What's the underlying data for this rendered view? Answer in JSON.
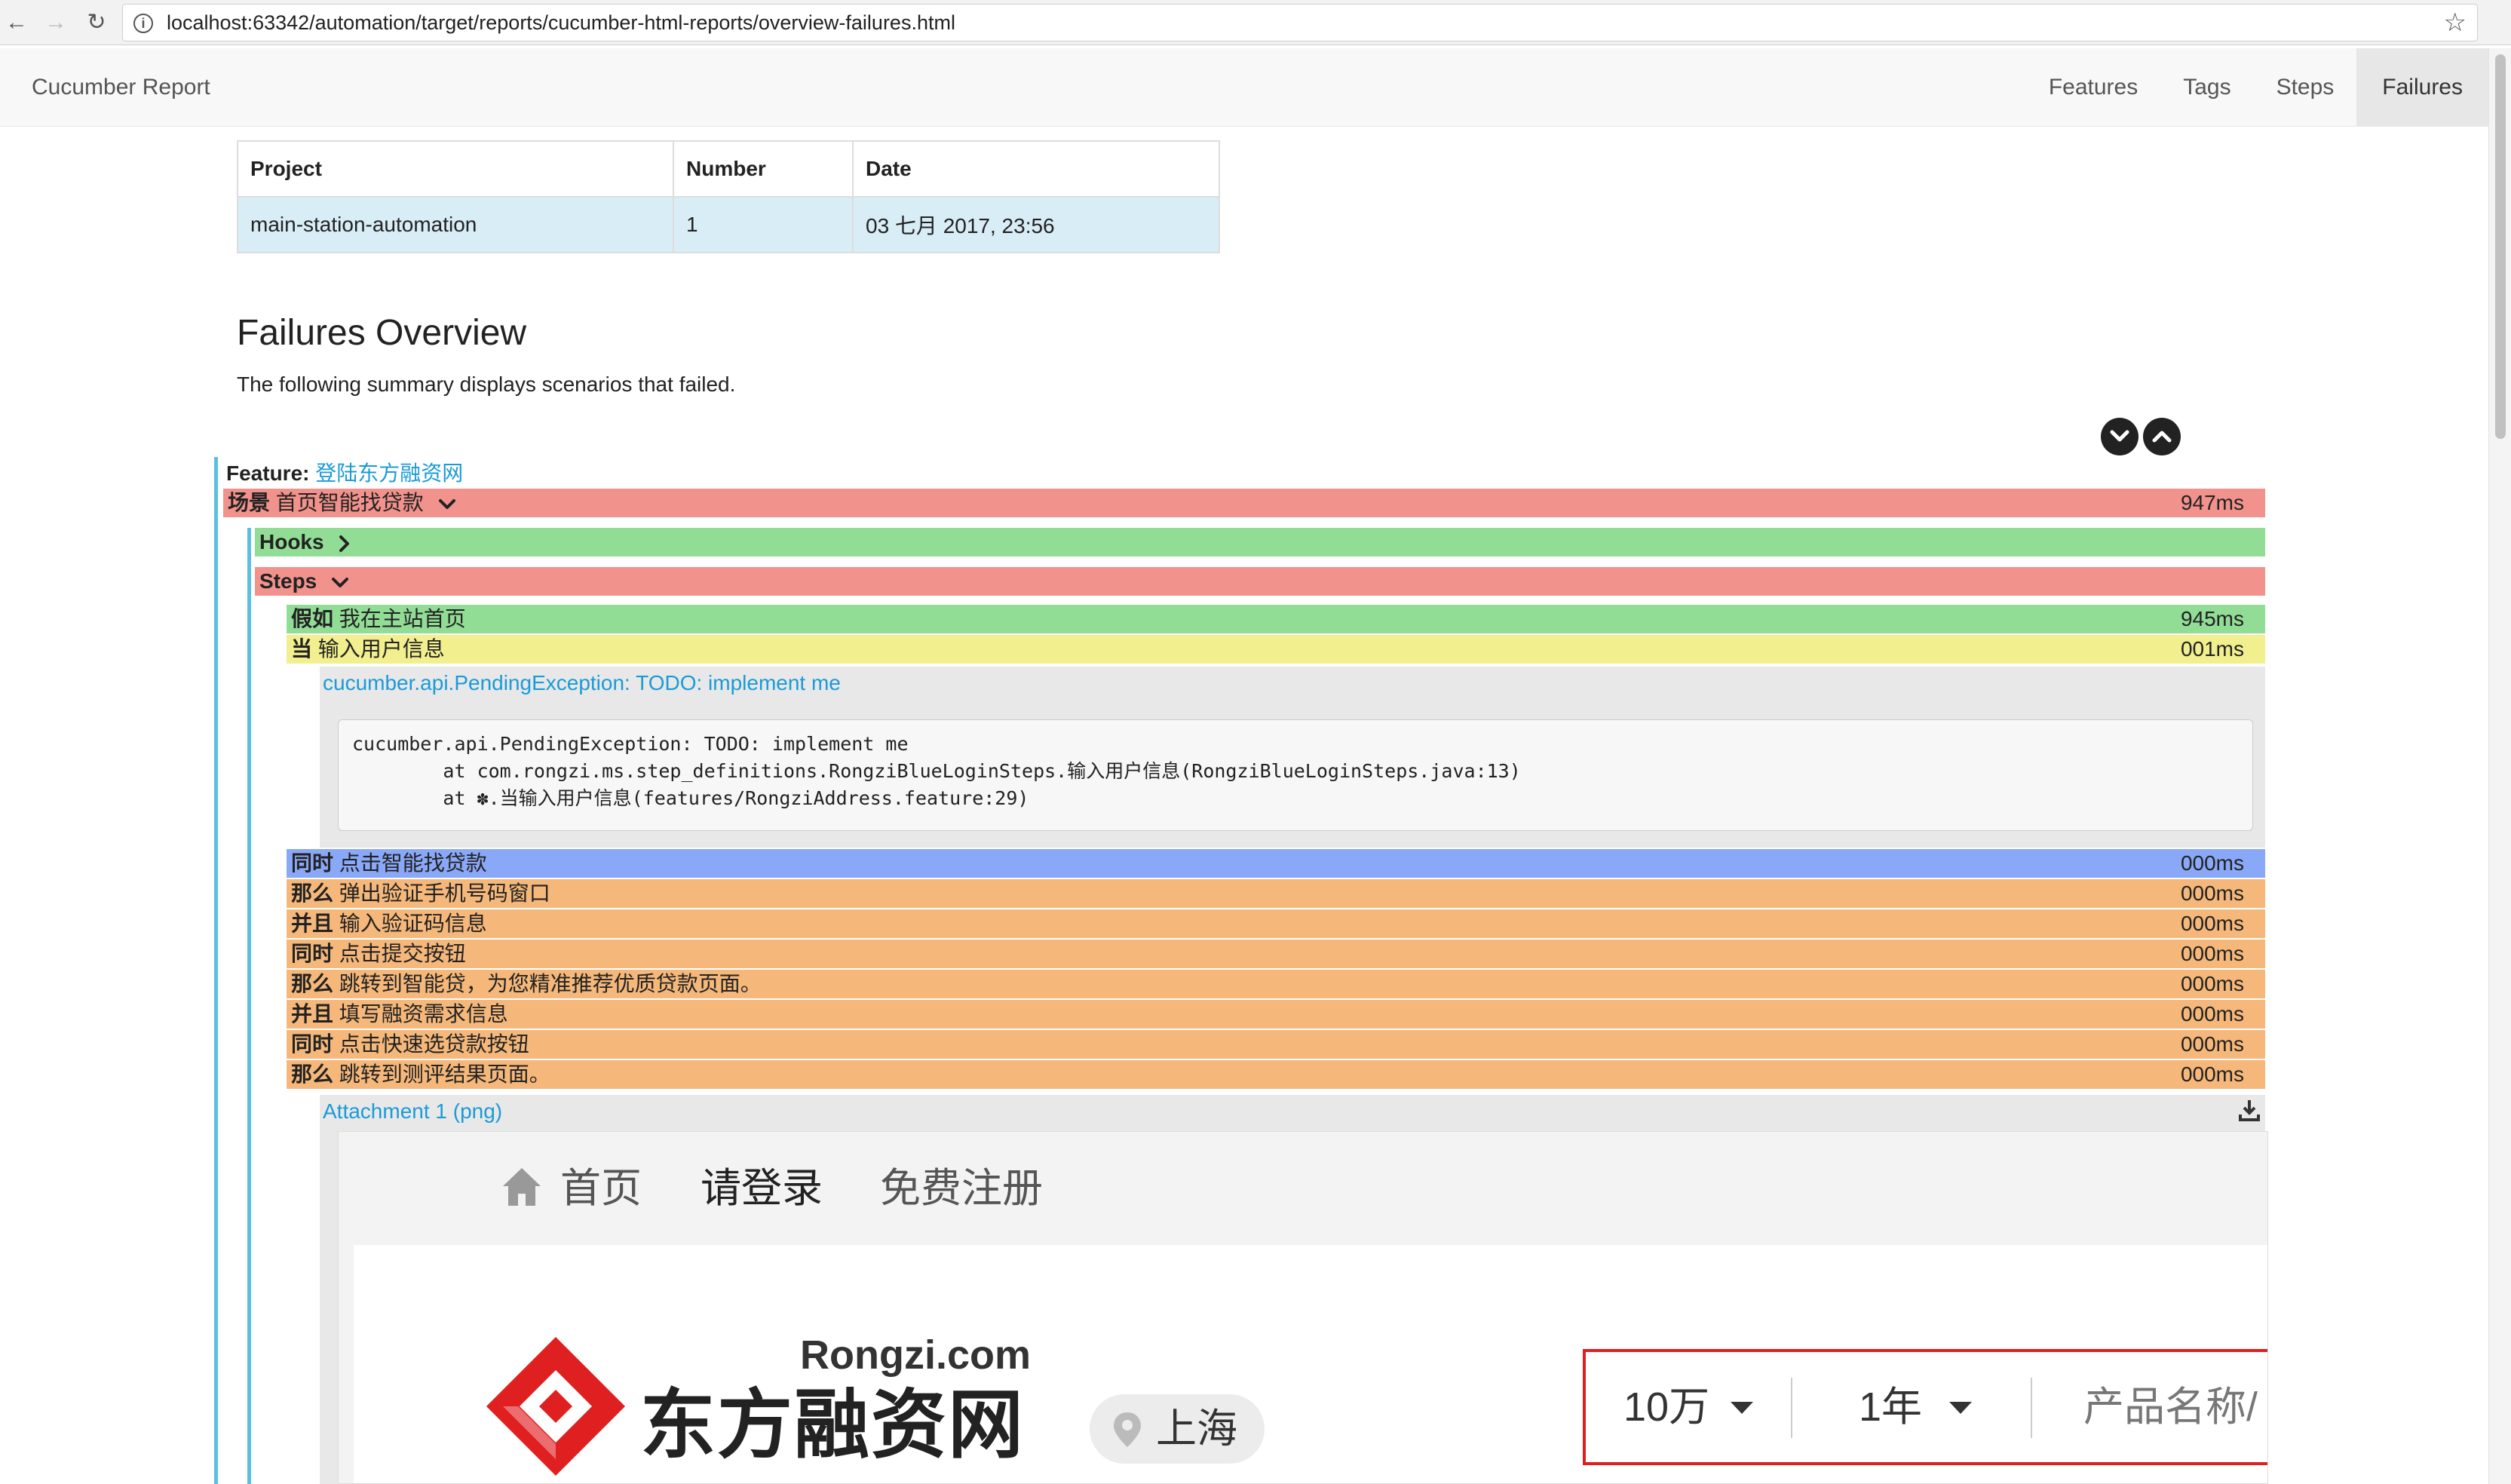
{
  "browser": {
    "url": "localhost:63342/automation/target/reports/cucumber-html-reports/overview-failures.html"
  },
  "navbar": {
    "brand": "Cucumber Report",
    "links": [
      "Features",
      "Tags",
      "Steps",
      "Failures"
    ],
    "active": "Failures"
  },
  "info_table": {
    "headers": [
      "Project",
      "Number",
      "Date"
    ],
    "row": [
      "main-station-automation",
      "1",
      "03 七月 2017, 23:56"
    ]
  },
  "page": {
    "title": "Failures Overview",
    "subtitle": "The following summary displays scenarios that failed."
  },
  "feature": {
    "label": "Feature:",
    "name": "登陆东方融资网"
  },
  "scenario": {
    "keyword": "场景",
    "name": "首页智能找贷款",
    "duration": "947ms"
  },
  "hooks": {
    "label": "Hooks"
  },
  "steps_section": {
    "label": "Steps"
  },
  "steps": [
    {
      "keyword": "假如",
      "text": "我在主站首页",
      "duration": "945ms",
      "status": "passed"
    },
    {
      "keyword": "当",
      "text": "输入用户信息",
      "duration": "001ms",
      "status": "pending"
    },
    {
      "keyword": "同时",
      "text": "点击智能找贷款",
      "duration": "000ms",
      "status": "undefined"
    },
    {
      "keyword": "那么",
      "text": "弹出验证手机号码窗口",
      "duration": "000ms",
      "status": "skipped"
    },
    {
      "keyword": "并且",
      "text": "输入验证码信息",
      "duration": "000ms",
      "status": "skipped"
    },
    {
      "keyword": "同时",
      "text": "点击提交按钮",
      "duration": "000ms",
      "status": "skipped"
    },
    {
      "keyword": "那么",
      "text": "跳转到智能贷，为您精准推荐优质贷款页面。",
      "duration": "000ms",
      "status": "skipped"
    },
    {
      "keyword": "并且",
      "text": "填写融资需求信息",
      "duration": "000ms",
      "status": "skipped"
    },
    {
      "keyword": "同时",
      "text": "点击快速选贷款按钮",
      "duration": "000ms",
      "status": "skipped"
    },
    {
      "keyword": "那么",
      "text": "跳转到测评结果页面。",
      "duration": "000ms",
      "status": "skipped"
    }
  ],
  "error": {
    "title": "cucumber.api.PendingException: TODO: implement me",
    "stack": "cucumber.api.PendingException: TODO: implement me\n        at com.rongzi.ms.step_definitions.RongziBlueLoginSteps.输入用户信息(RongziBlueLoginSteps.java:13)\n        at ✽.当输入用户信息(features/RongziAddress.feature:29)"
  },
  "attachment": {
    "title": "Attachment 1 (png)",
    "screenshot": {
      "nav_items": [
        "首页",
        "请登录",
        "免费注册"
      ],
      "logo_domain": "Rongzi.com",
      "brand_name": "东方融资网",
      "city": "上海",
      "search_fields": [
        "10万",
        "1年",
        "产品名称/"
      ]
    }
  },
  "colors": {
    "failed": "#f2928c",
    "passed": "#92dd96",
    "pending": "#f2ef8e",
    "undefined": "#8aa8f8",
    "skipped": "#f5b87a",
    "link": "#1a9bd7",
    "accent_bar": "#5bc0de",
    "brand_red": "#e02020"
  }
}
